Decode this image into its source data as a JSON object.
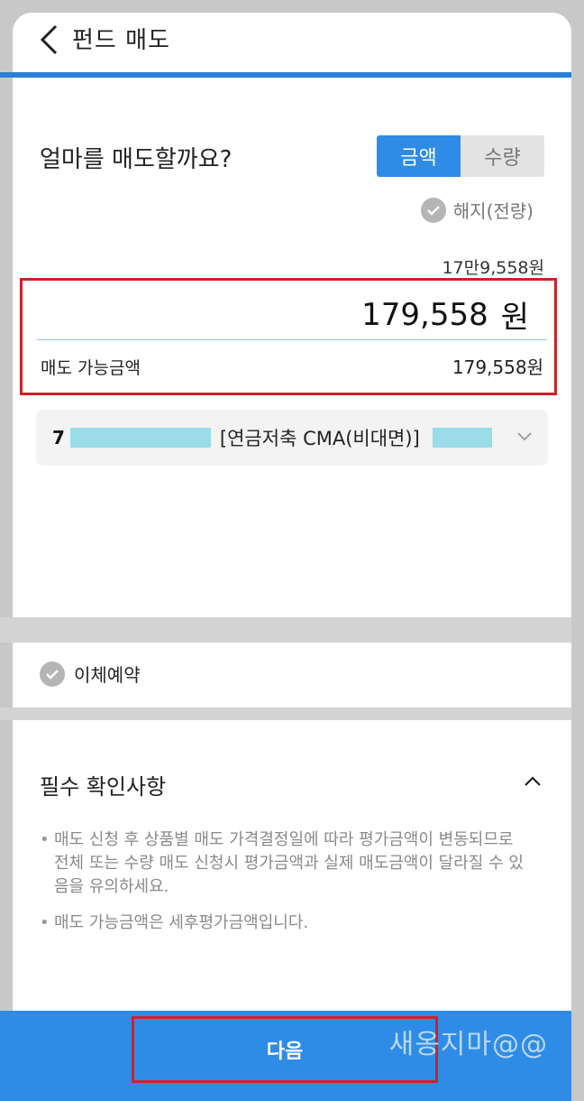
{
  "header": {
    "title": "펀드 매도"
  },
  "form": {
    "question": "얼마를 매도할까요?",
    "toggle": {
      "amount_label": "금액",
      "quantity_label": "수량",
      "selected": "금액"
    },
    "full_redemption_label": "해지(전량)",
    "amount_korean": "17만9,558원",
    "amount_value": "179,558",
    "amount_unit": "원",
    "available_label": "매도 가능금액",
    "available_value": "179,558원"
  },
  "account": {
    "prefix": "7",
    "name": "[연금저축 CMA(비대면)]"
  },
  "transfer": {
    "label": "이체예약"
  },
  "notice": {
    "title": "필수 확인사항",
    "items": [
      "매도 신청 후 상품별 매도 가격결정일에 따라 평가금액이 변동되므로 전체 또는 수량 매도 신청시 평가금액과 실제 매도금액이 달라질 수 있음을 유의하세요.",
      "매도 가능금액은 세후평가금액입니다."
    ]
  },
  "footer": {
    "next_label": "다음",
    "watermark": "새옹지마@@"
  }
}
